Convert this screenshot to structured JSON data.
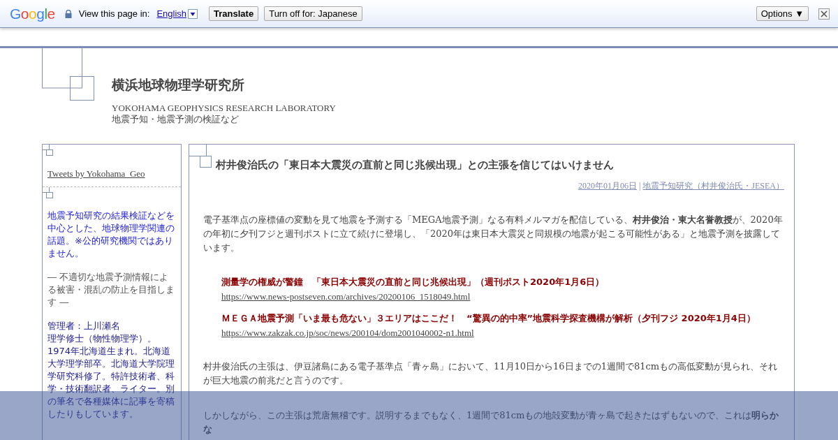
{
  "translate_bar": {
    "logo": "Google",
    "prompt": "View this page in:",
    "language": "English",
    "translate_button": "Translate",
    "turn_off_button": "Turn off for: Japanese",
    "options_button": "Options ▼"
  },
  "header": {
    "title": "横浜地球物理学研究所",
    "subtitle": "YOKOHAMA GEOPHYSICS RESEARCH LABORATORY",
    "tagline": "地震予知・地震予測の検証など"
  },
  "sidebar": {
    "tweets_link": "Tweets by Yokohama_Geo",
    "description": "地震予知研究の結果検証などを中心とした、地球物理学関連の話題。※公的研究機関ではありません。",
    "motto": "― 不適切な地震予測情報による被害・混乱の防止を目指します ―",
    "admin": "管理者：上川瀬名",
    "bio": "理学修士（物性物理学）。1974年北海道生まれ。北海道大学理学部卒。北海道大学院理学研究科修了。特許技術者、科学・技術翻訳者、ライター。別の筆名で各種媒体に記事を寄稿したりもしています。"
  },
  "article": {
    "title": "村井俊治氏の「東日本大震災の直前と同じ兆候出現」との主張を信じてはいけません",
    "date": "2020年01月06日",
    "separator": "|",
    "category": "地震予知研究（村井俊治氏・JESEA）",
    "intro": "電子基準点の座標値の変動を見て地震を予測する「MEGA地震予測」なる有料メルマガを配信している、**村井俊治・東大名誉教授**が、2020年の年初に夕刊フジと週刊ポストに立て続けに登場し、「2020年は東日本大震災と同規模の地震が起こる可能性がある」と地震予測を披露しています。",
    "sources": [
      {
        "headline": "測量学の権威が警鐘　「東日本大震災の直前と同じ兆候出現」（週刊ポスト2020年1月6日）",
        "url": "https://www.news-postseven.com/archives/20200106_1518049.html"
      },
      {
        "headline": "ＭＥＧＡ地震予測「いま最も危ない」３エリアはここだ！　“驚異の的中率”地震科学探査機構が解析（夕刊フジ 2020年1月4日）",
        "url": "https://www.zakzak.co.jp/soc/news/200104/dom2001040002-n1.html"
      }
    ],
    "paragraphs": [
      "村井俊治氏の主張は、伊豆諸島にある電子基準点「青ヶ島」において、11月10日から16日までの1週間で81cmもの高低変動が見られ、それが巨大地震の前兆だと言うのです。",
      "しかしながら、この主張は荒唐無稽です。説明するまでもなく、1週間で81cmもの地殻変動が青ヶ島で起きたはずもないので、これは**明らかな**"
    ]
  }
}
